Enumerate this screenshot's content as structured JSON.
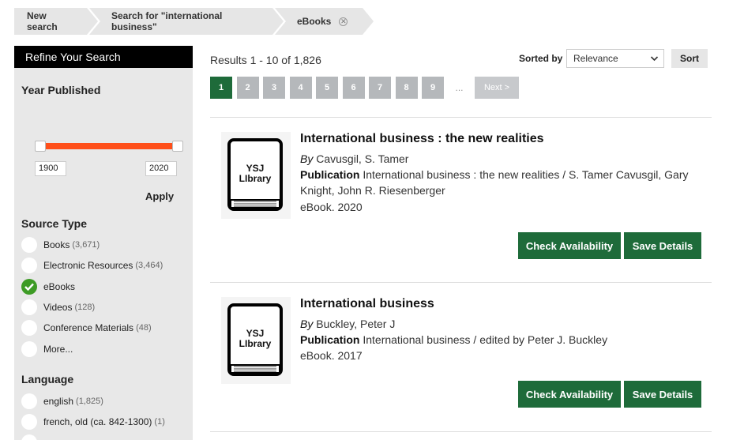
{
  "breadcrumb": {
    "new_search": "New search",
    "search_for": "Search for \"international business\"",
    "current": "eBooks",
    "remove": "✕"
  },
  "sidebar": {
    "heading": "Refine Your Search",
    "year_published": {
      "label": "Year Published",
      "from": "1900",
      "to": "2020",
      "apply": "Apply"
    },
    "source_type": {
      "label": "Source Type",
      "items": [
        {
          "label": "Books",
          "count": "(3,671)",
          "checked": false
        },
        {
          "label": "Electronic Resources",
          "count": "(3,464)",
          "checked": false
        },
        {
          "label": "eBooks",
          "count": "",
          "checked": true
        },
        {
          "label": "Videos",
          "count": "(128)",
          "checked": false
        },
        {
          "label": "Conference Materials",
          "count": "(48)",
          "checked": false
        },
        {
          "label": "More...",
          "count": "",
          "checked": false
        }
      ]
    },
    "language": {
      "label": "Language",
      "items": [
        {
          "label": "english",
          "count": "(1,825)"
        },
        {
          "label": "french, old (ca. 842-1300)",
          "count": "(1)"
        }
      ]
    }
  },
  "results": {
    "summary": "Results 1 - 10 of 1,826",
    "sorted_by_label": "Sorted by",
    "sort_value": "Relevance",
    "sort_button": "Sort",
    "pages": [
      "1",
      "2",
      "3",
      "4",
      "5",
      "6",
      "7",
      "8",
      "9"
    ],
    "ellipsis": "...",
    "next": "Next >",
    "items": [
      {
        "cover_text": "YSJ LIbrary",
        "title": "International business : the new realities",
        "by_label": "By",
        "author": "Cavusgil, S. Tamer",
        "publication_label": "Publication",
        "publication": "International business : the new realities / S. Tamer Cavusgil, Gary Knight, John R. Riesenberger",
        "format": "eBook. 2020",
        "check": "Check Availability",
        "save": "Save Details"
      },
      {
        "cover_text": "YSJ LIbrary",
        "title": "International business",
        "by_label": "By",
        "author": "Buckley, Peter J",
        "publication_label": "Publication",
        "publication": "International business / edited by Peter J. Buckley",
        "format": "eBook. 2017",
        "check": "Check Availability",
        "save": "Save Details"
      }
    ]
  },
  "colors": {
    "accent_green": "#1e6b3a",
    "slider_orange": "#ff4f1a",
    "check_green": "#3d9b25"
  }
}
